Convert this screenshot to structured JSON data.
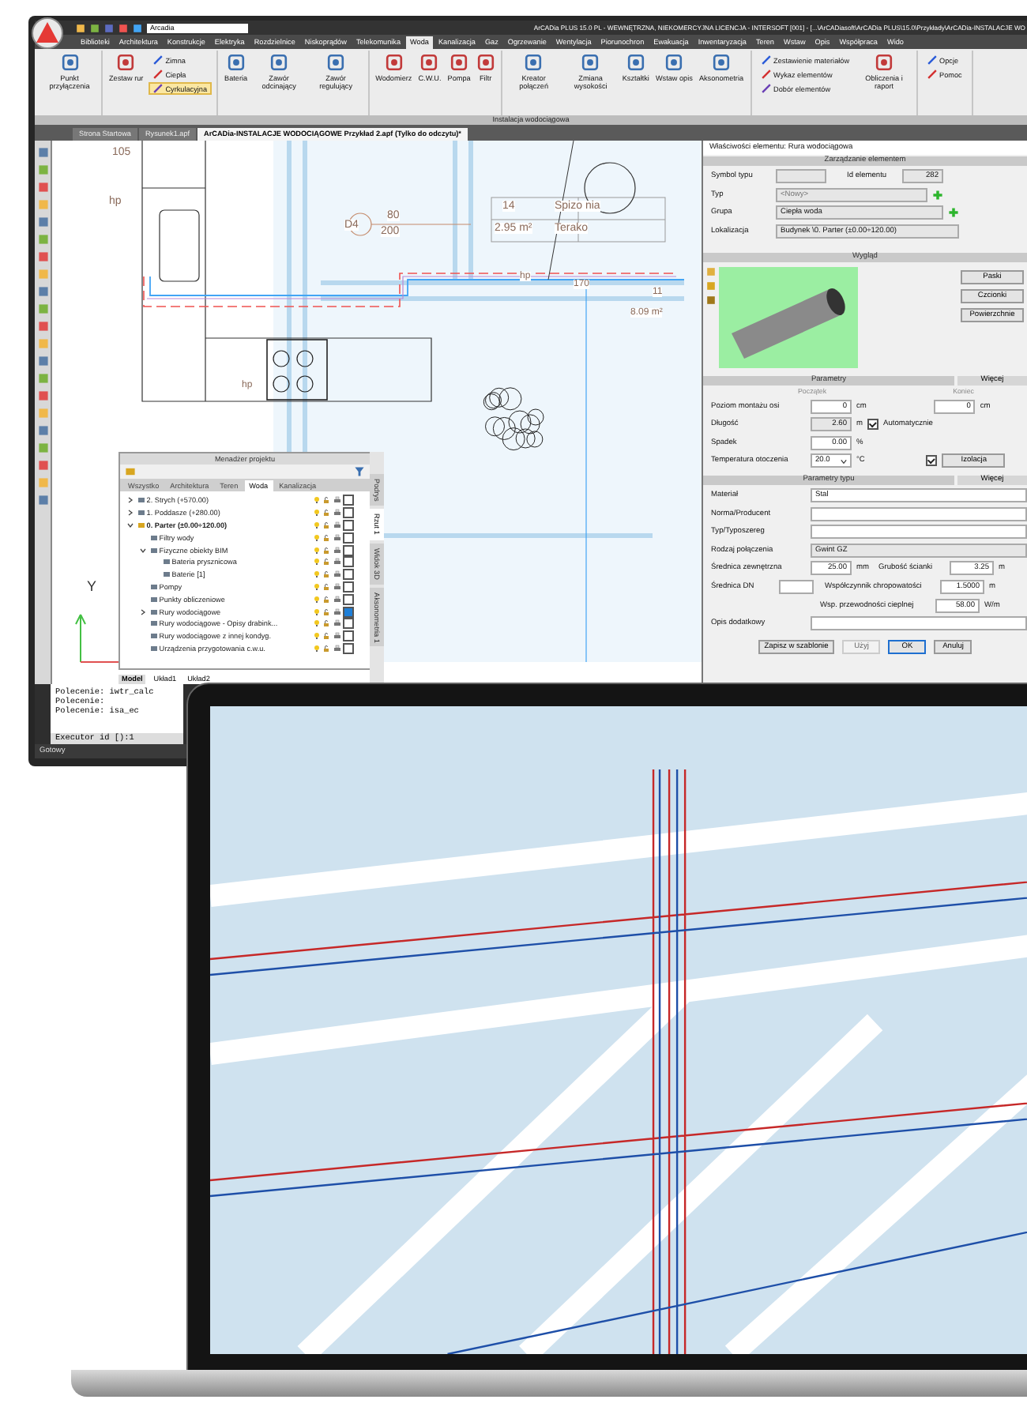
{
  "app": {
    "title": "ArCADia PLUS 15.0 PL - WEWNĘTRZNA, NIEKOMERCYJNA LICENCJA - INTERSOFT [001] - [...\\ArCADiasoft\\ArCADia PLUS\\15.0\\Przykłady\\ArCADia-INSTALACJE WO",
    "layer": "Arcadia",
    "ribbon_tabs": [
      {
        "label": "Biblioteki",
        "selected": false
      },
      {
        "label": "Architektura",
        "selected": false
      },
      {
        "label": "Konstrukcje",
        "selected": false
      },
      {
        "label": "Elektryka",
        "selected": false
      },
      {
        "label": "Rozdzielnice",
        "selected": false
      },
      {
        "label": "Niskoprądów",
        "selected": false
      },
      {
        "label": "Telekomunika",
        "selected": false
      },
      {
        "label": "Woda",
        "selected": true
      },
      {
        "label": "Kanalizacja",
        "selected": false
      },
      {
        "label": "Gaz",
        "selected": false
      },
      {
        "label": "Ogrzewanie",
        "selected": false
      },
      {
        "label": "Wentylacja",
        "selected": false
      },
      {
        "label": "Piorunochron",
        "selected": false
      },
      {
        "label": "Ewakuacja",
        "selected": false
      },
      {
        "label": "Inwentaryzacja",
        "selected": false
      },
      {
        "label": "Teren",
        "selected": false
      },
      {
        "label": "Wstaw",
        "selected": false
      },
      {
        "label": "Opis",
        "selected": false
      },
      {
        "label": "Współpraca",
        "selected": false
      },
      {
        "label": "Wido",
        "selected": false
      }
    ],
    "ribbon_groups": [
      {
        "buttons": [
          {
            "kind": "large",
            "label": "Punkt przyłączenia"
          }
        ]
      },
      {
        "buttons": [
          {
            "kind": "large",
            "label": "Zestaw rur"
          },
          {
            "kind": "stack",
            "items": [
              {
                "label": "Zimna",
                "selected": false
              },
              {
                "label": "Ciepła",
                "selected": false
              },
              {
                "label": "Cyrkulacyjna",
                "selected": true
              }
            ]
          }
        ]
      },
      {
        "buttons": [
          {
            "kind": "large",
            "label": "Bateria"
          },
          {
            "kind": "large",
            "label": "Zawór odcinający"
          },
          {
            "kind": "large",
            "label": "Zawór regulujący"
          }
        ]
      },
      {
        "buttons": [
          {
            "kind": "large",
            "label": "Wodomierz"
          },
          {
            "kind": "large",
            "label": "C.W.U."
          },
          {
            "kind": "large",
            "label": "Pompa"
          },
          {
            "kind": "large",
            "label": "Filtr"
          }
        ]
      },
      {
        "buttons": [
          {
            "kind": "large",
            "label": "Kreator połączeń"
          },
          {
            "kind": "large",
            "label": "Zmiana wysokości"
          },
          {
            "kind": "large",
            "label": "Kształtki"
          },
          {
            "kind": "large",
            "label": "Wstaw opis"
          },
          {
            "kind": "large",
            "label": "Aksonometria"
          }
        ]
      },
      {
        "buttons": [
          {
            "kind": "stack",
            "items": [
              {
                "label": "Zestawienie materiałów",
                "selected": false
              },
              {
                "label": "Wykaz elementów",
                "selected": false
              },
              {
                "label": "Dobór elementów",
                "selected": false
              }
            ]
          },
          {
            "kind": "large",
            "label": "Obliczenia i raport"
          }
        ]
      },
      {
        "buttons": [
          {
            "kind": "stack",
            "items": [
              {
                "label": "Opcje",
                "selected": false
              },
              {
                "label": "Pomoc",
                "selected": false
              }
            ]
          }
        ]
      }
    ],
    "ribbon_group_title": "Instalacja wodociągowa",
    "doc_tabs": [
      {
        "label": "Strona Startowa",
        "selected": false
      },
      {
        "label": "Rysunek1.apf",
        "selected": false
      },
      {
        "label": "ArCADia-INSTALACJE WODOCIĄGOWE Przykład 2.apf (Tylko do odczytu)*",
        "selected": true
      }
    ],
    "plan_labels": [
      "105",
      "hp",
      "D4",
      "80",
      "200",
      "14",
      "Spizo nia",
      "2.95 m²",
      "Terako",
      "hp",
      "170",
      "11",
      "8.09 m²",
      "hp",
      "Y"
    ],
    "project_manager": {
      "title": "Menadżer projektu",
      "tabs": [
        {
          "label": "Wszystko",
          "selected": false
        },
        {
          "label": "Architektura",
          "selected": false
        },
        {
          "label": "Teren",
          "selected": false
        },
        {
          "label": "Woda",
          "selected": true
        },
        {
          "label": "Kanalizacja",
          "selected": false
        }
      ],
      "tree": [
        {
          "label": "2. Strych (+570.00)",
          "expanded": false,
          "checked": false
        },
        {
          "label": "1. Poddasze (+280.00)",
          "expanded": false,
          "checked": false
        },
        {
          "label": "0. Parter (±0.00÷120.00)",
          "expanded": true,
          "active": true,
          "checked": false,
          "children": [
            {
              "label": "Filtry wody",
              "checked": false
            },
            {
              "label": "Fizyczne obiekty BIM",
              "expanded": true,
              "checked": false,
              "children": [
                {
                  "label": "Bateria prysznicowa",
                  "checked": false
                },
                {
                  "label": "Baterie [1]",
                  "checked": false
                }
              ]
            },
            {
              "label": "Pompy",
              "checked": false
            },
            {
              "label": "Punkty obliczeniowe",
              "checked": false
            },
            {
              "label": "Rury wodociągowe",
              "expanded": false,
              "checked": true
            },
            {
              "label": "Rury wodociągowe - Opisy drabink...",
              "checked": false
            },
            {
              "label": "Rury wodociągowe z innej kondyg.",
              "checked": false
            },
            {
              "label": "Urządzenia przygotowania c.w.u.",
              "checked": false
            }
          ]
        }
      ],
      "view_tabs": [
        {
          "label": "Podrys",
          "selected": false
        },
        {
          "label": "Rzut 1",
          "selected": true
        },
        {
          "label": "Widok 3D",
          "selected": false
        },
        {
          "label": "Aksonometria 1",
          "selected": false
        }
      ]
    },
    "layout_tabs": [
      {
        "label": "Model",
        "selected": true
      },
      {
        "label": "Układ1",
        "selected": false
      },
      {
        "label": "Układ2",
        "selected": false
      }
    ],
    "command_history": [
      "Polecenie: iwtr_calc",
      "Polecenie:",
      "Polecenie: isa_ec"
    ],
    "command_input": "Executor id [):1",
    "status": "Gotowy",
    "properties": {
      "title": "Właściwości elementu: Rura wodociągowa",
      "management": {
        "title": "Zarządzanie elementem",
        "symbol_label": "Symbol typu",
        "id_label": "Id elementu",
        "id_value": "282",
        "type_label": "Typ",
        "type_value": "<Nowy>",
        "group_label": "Grupa",
        "group_value": "Ciepła woda",
        "location_label": "Lokalizacja",
        "location_value": "Budynek \\0. Parter (±0.00÷120.00)"
      },
      "appearance": {
        "title": "Wygląd",
        "buttons": [
          "Paski",
          "Czcionki",
          "Powierzchnie"
        ]
      },
      "parameters": {
        "title": "Parametry",
        "more": "Więcej",
        "start": "Początek",
        "end": "Koniec",
        "mount_label": "Poziom montażu osi",
        "mount_start": "0",
        "mount_end": "0",
        "mount_unit": "cm",
        "mount_end_unit": "cm",
        "length_label": "Długość",
        "length_value": "2.60",
        "length_unit": "m",
        "auto_label": "Automatycznie",
        "auto_checked": true,
        "slope_label": "Spadek",
        "slope_value": "0.00",
        "slope_unit": "%",
        "temp_label": "Temperatura otoczenia",
        "temp_value": "20.0",
        "temp_unit": "°C",
        "insulation_checked": true,
        "insulation_button": "Izolacja"
      },
      "type_parameters": {
        "title": "Parametry typu",
        "more": "Więcej",
        "material_label": "Materiał",
        "material_value": "Stal",
        "standard_label": "Norma/Producent",
        "series_label": "Typ/Typoszereg",
        "connection_label": "Rodzaj połączenia",
        "connection_value": "Gwint GZ",
        "outer_label": "Średnica zewnętrzna",
        "outer_value": "25.00",
        "outer_unit": "mm",
        "wall_label": "Grubość ścianki",
        "wall_value": "3.25",
        "wall_unit": "m",
        "dn_label": "Średnica DN",
        "rough_label": "Współczynnik chropowatości",
        "rough_value": "1.5000",
        "rough_unit": "m",
        "cond_label": "Wsp. przewodności cieplnej",
        "cond_value": "58.00",
        "cond_unit": "W/m",
        "note_label": "Opis dodatkowy"
      },
      "buttons": [
        {
          "label": "Zapisz w szablonie",
          "disabled": false
        },
        {
          "label": "Użyj",
          "disabled": true
        },
        {
          "label": "OK",
          "disabled": false
        },
        {
          "label": "Anuluj",
          "disabled": false
        }
      ]
    }
  }
}
